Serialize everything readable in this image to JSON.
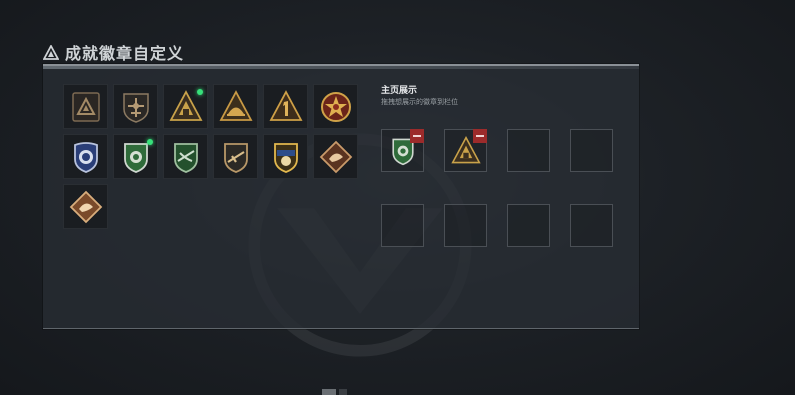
{
  "header": {
    "title": "成就徽章自定义",
    "icon": "triangle-warning-icon"
  },
  "badges": [
    {
      "id": "b1",
      "icon": "triangle-plain-badge-icon",
      "new": false
    },
    {
      "id": "b2",
      "icon": "shield-aircraft-badge-icon",
      "new": false
    },
    {
      "id": "b3",
      "icon": "triangle-gold-ring-badge-icon",
      "new": true
    },
    {
      "id": "b4",
      "icon": "triangle-helmet-badge-icon",
      "new": false
    },
    {
      "id": "b5",
      "icon": "triangle-number-one-badge-icon",
      "new": false
    },
    {
      "id": "b6",
      "icon": "red-star-medal-badge-icon",
      "new": false
    },
    {
      "id": "b7",
      "icon": "blue-police-badge-icon",
      "new": false
    },
    {
      "id": "b8",
      "icon": "green-shield-lion-badge-icon",
      "new": true
    },
    {
      "id": "b9",
      "icon": "green-shield-eagle-badge-icon",
      "new": false
    },
    {
      "id": "b10",
      "icon": "bronze-shield-rifle-badge-icon",
      "new": false
    },
    {
      "id": "b11",
      "icon": "gold-crest-skull-badge-icon",
      "new": false
    },
    {
      "id": "b12",
      "icon": "diamond-dragon-badge-icon",
      "new": false
    },
    {
      "id": "b13",
      "icon": "diamond-bronze-dragon-badge-icon",
      "new": false
    }
  ],
  "showcase": {
    "title": "主页展示",
    "hint": "拖拽想展示的徽章到栏位",
    "slots": [
      {
        "filled": true,
        "icon": "green-shield-lion-badge-icon"
      },
      {
        "filled": true,
        "icon": "triangle-gold-ring-badge-icon"
      },
      {
        "filled": false
      },
      {
        "filled": false
      },
      {
        "filled": false
      },
      {
        "filled": false
      },
      {
        "filled": false
      },
      {
        "filled": false
      }
    ]
  },
  "colors": {
    "accent_green": "#37e07a",
    "remove_red": "#9c2b2b",
    "gold": "#c9a24a",
    "bronze": "#a8744a",
    "military_green": "#2f6b3a"
  }
}
